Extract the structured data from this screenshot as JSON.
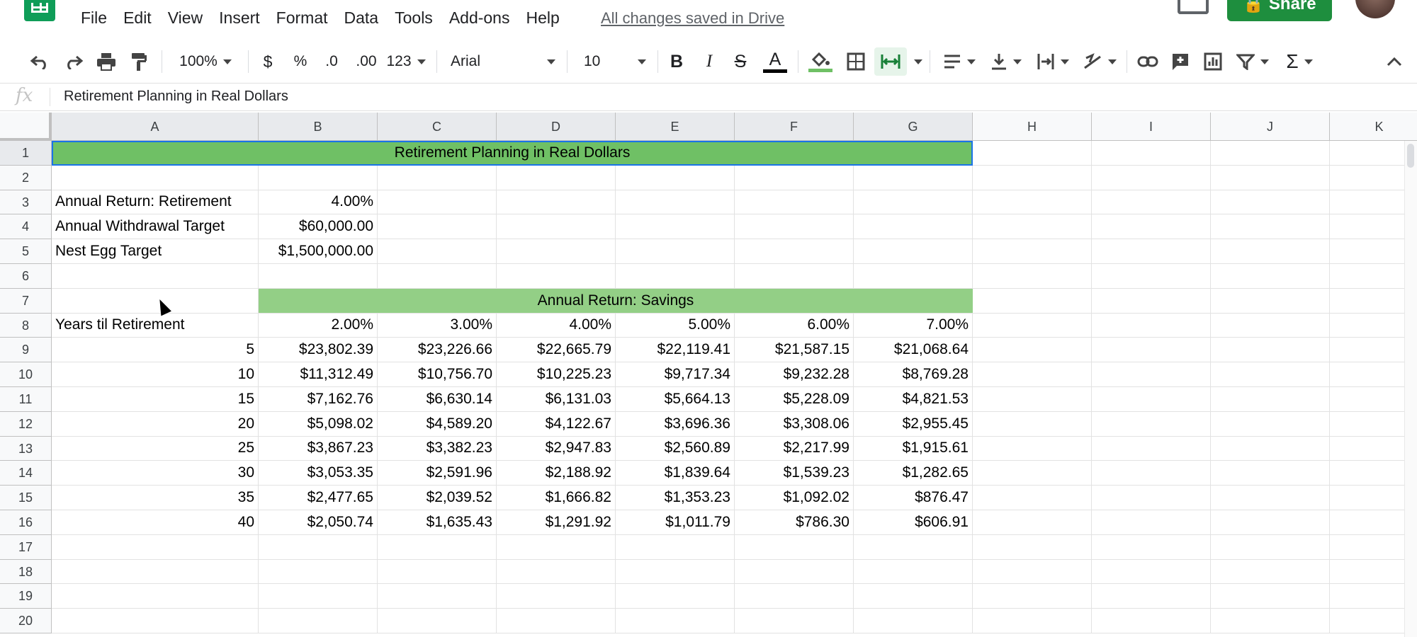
{
  "menubar": {
    "items": [
      "File",
      "Edit",
      "View",
      "Insert",
      "Format",
      "Data",
      "Tools",
      "Add-ons",
      "Help"
    ],
    "save_status": "All changes saved in Drive",
    "share_label": "Share"
  },
  "toolbar": {
    "zoom": "100%",
    "currency_label": "$",
    "percent_label": "%",
    "decrease_decimal_label": ".0",
    "increase_decimal_label": ".00",
    "more_formats_label": "123",
    "font": "Arial",
    "font_size": "10",
    "bold_label": "B",
    "italic_label": "I",
    "strike_label": "S",
    "text_color_label": "A",
    "text_color": "#000000",
    "fill_color": "#6fc065",
    "sum_label": "Σ"
  },
  "formula_bar": {
    "fx_label": "fx",
    "content": "Retirement Planning in Real Dollars"
  },
  "sheet": {
    "columns": [
      "A",
      "B",
      "C",
      "D",
      "E",
      "F",
      "G",
      "H",
      "I",
      "J",
      "K"
    ],
    "rows": [
      "1",
      "2",
      "3",
      "4",
      "5",
      "6",
      "7",
      "8",
      "9",
      "10",
      "11",
      "12",
      "13",
      "14",
      "15",
      "16",
      "17",
      "18",
      "19",
      "20"
    ],
    "title": "Retirement Planning in Real Dollars",
    "params": [
      {
        "label": "Annual Return: Retirement",
        "value": "4.00%"
      },
      {
        "label": "Annual Withdrawal Target",
        "value": "$60,000.00"
      },
      {
        "label": "Nest Egg Target",
        "value": "$1,500,000.00"
      }
    ],
    "savings_header": "Annual Return: Savings",
    "years_label": "Years til Retirement",
    "rates": [
      "2.00%",
      "3.00%",
      "4.00%",
      "5.00%",
      "6.00%",
      "7.00%"
    ],
    "table": [
      {
        "years": "5",
        "values": [
          "$23,802.39",
          "$23,226.66",
          "$22,665.79",
          "$22,119.41",
          "$21,587.15",
          "$21,068.64"
        ]
      },
      {
        "years": "10",
        "values": [
          "$11,312.49",
          "$10,756.70",
          "$10,225.23",
          "$9,717.34",
          "$9,232.28",
          "$8,769.28"
        ]
      },
      {
        "years": "15",
        "values": [
          "$7,162.76",
          "$6,630.14",
          "$6,131.03",
          "$5,664.13",
          "$5,228.09",
          "$4,821.53"
        ]
      },
      {
        "years": "20",
        "values": [
          "$5,098.02",
          "$4,589.20",
          "$4,122.67",
          "$3,696.36",
          "$3,308.06",
          "$2,955.45"
        ]
      },
      {
        "years": "25",
        "values": [
          "$3,867.23",
          "$3,382.23",
          "$2,947.83",
          "$2,560.89",
          "$2,217.99",
          "$1,915.61"
        ]
      },
      {
        "years": "30",
        "values": [
          "$3,053.35",
          "$2,591.96",
          "$2,188.92",
          "$1,839.64",
          "$1,539.23",
          "$1,282.65"
        ]
      },
      {
        "years": "35",
        "values": [
          "$2,477.65",
          "$2,039.52",
          "$1,666.82",
          "$1,353.23",
          "$1,092.02",
          "$876.47"
        ]
      },
      {
        "years": "40",
        "values": [
          "$2,050.74",
          "$1,635.43",
          "$1,291.92",
          "$1,011.79",
          "$786.30",
          "$606.91"
        ]
      }
    ]
  }
}
